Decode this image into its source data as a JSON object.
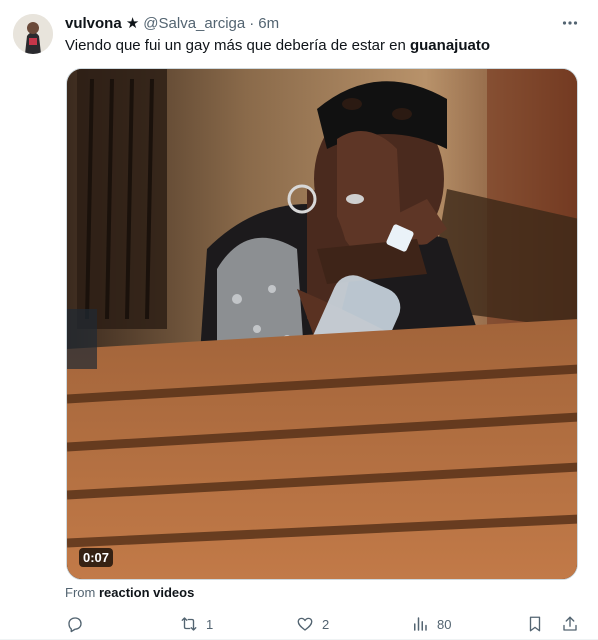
{
  "author": {
    "display_name": "vulvona ★",
    "handle": "@Salva_arciga",
    "separator": "·",
    "time": "6m"
  },
  "tweet": {
    "text_plain": "Viendo que fui un gay más que debería de estar en ",
    "text_bold": "guanajuato"
  },
  "media": {
    "duration": "0:07"
  },
  "source": {
    "prefix": "From",
    "link": "reaction videos"
  },
  "actions": {
    "reply_count": "",
    "retweet_count": "1",
    "like_count": "2",
    "views_count": "80"
  },
  "icons": {
    "more": "more-icon",
    "reply": "reply-icon",
    "retweet": "retweet-icon",
    "like": "heart-icon",
    "views": "views-icon",
    "bookmark": "bookmark-icon",
    "share": "share-icon"
  },
  "colors": {
    "text": "#0f1419",
    "secondary": "#536471",
    "border": "#cfd9de"
  }
}
